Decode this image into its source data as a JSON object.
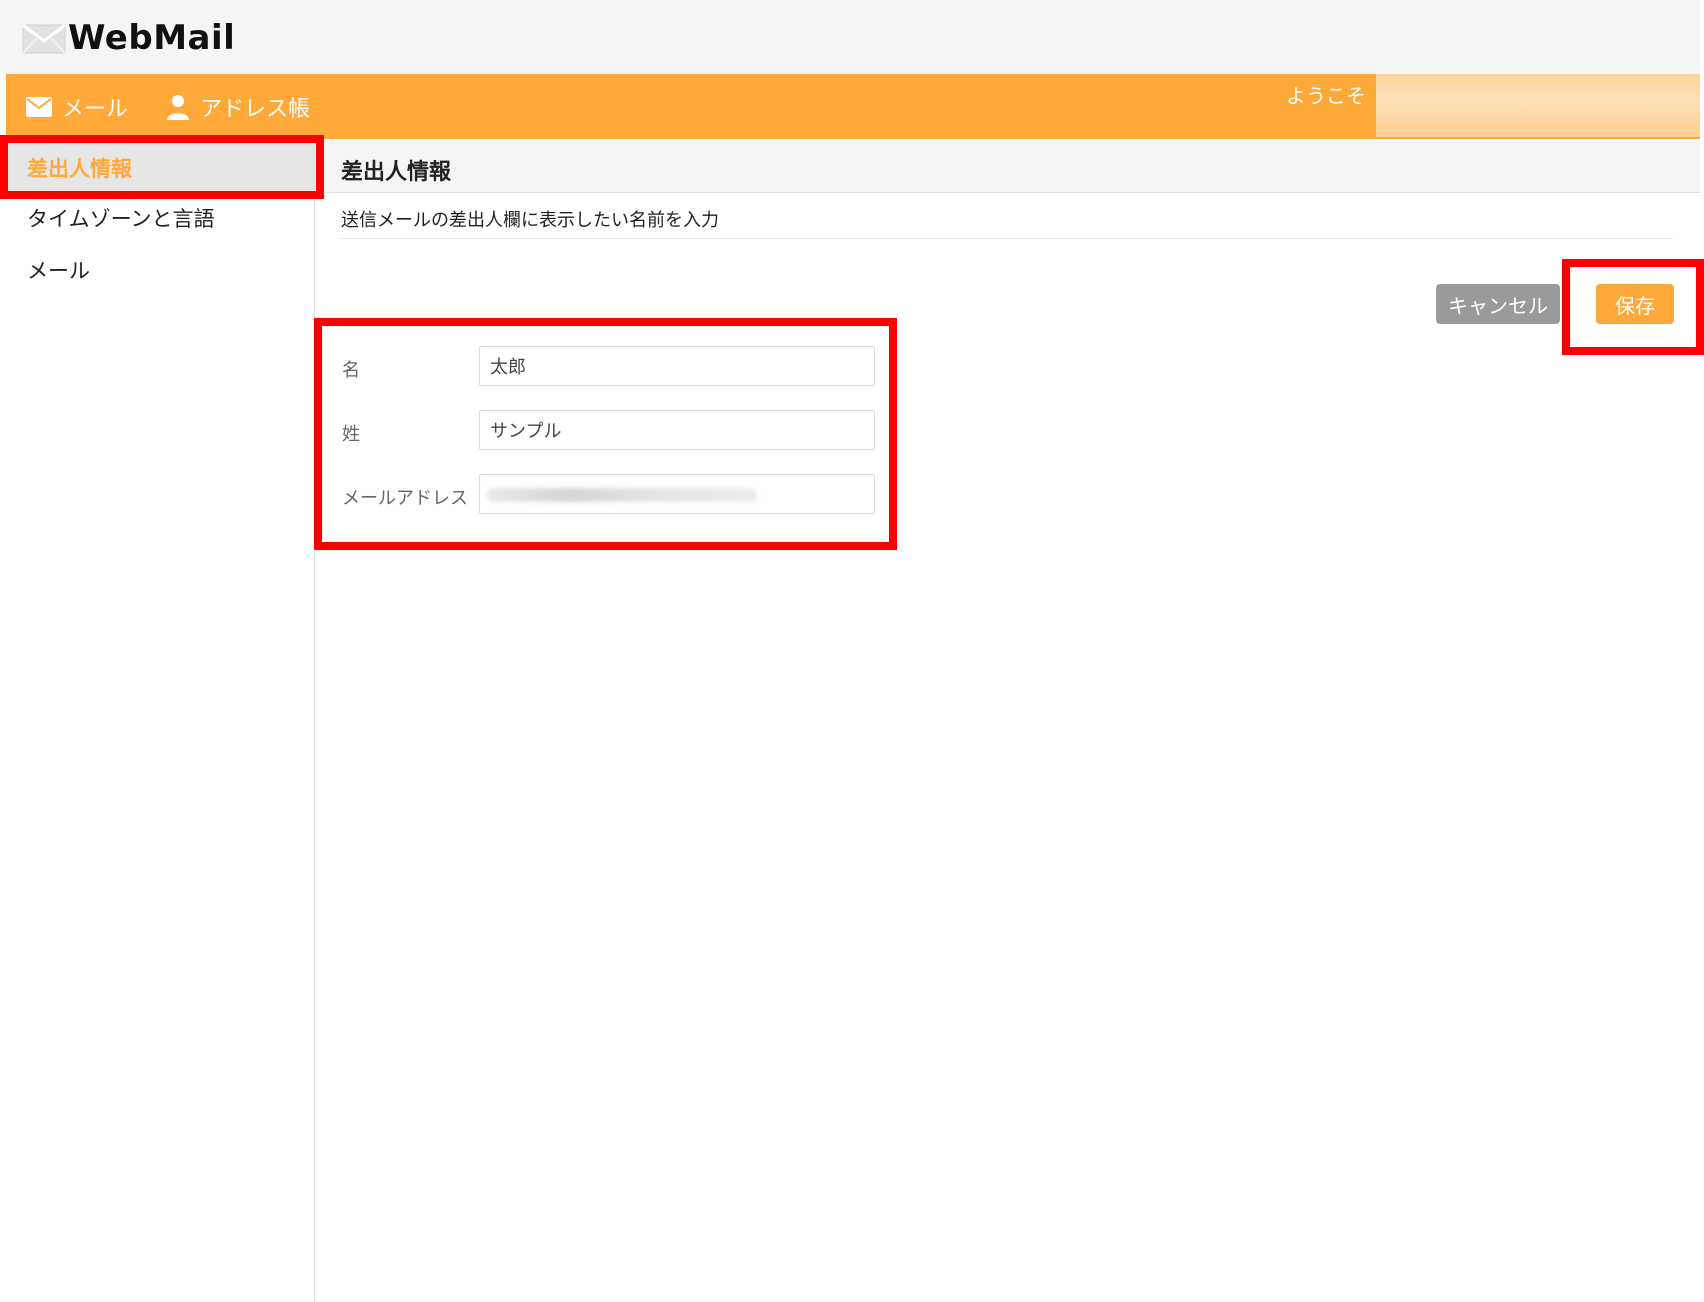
{
  "app": {
    "logo_text": "WebMail",
    "accent_color": "#ffa93a"
  },
  "nav": {
    "mail_label": "メール",
    "address_book_label": "アドレス帳",
    "welcome_label": "ようこそ"
  },
  "sidebar": {
    "items": [
      {
        "label": "差出人情報",
        "active": true
      },
      {
        "label": "タイムゾーンと言語",
        "active": false
      },
      {
        "label": "メール",
        "active": false
      }
    ]
  },
  "main": {
    "title": "差出人情報",
    "description": "送信メールの差出人欄に表示したい名前を入力",
    "cancel_label": "キャンセル",
    "save_label": "保存",
    "form": {
      "first_name_label": "名",
      "first_name_value": "太郎",
      "last_name_label": "姓",
      "last_name_value": "サンプル",
      "email_label": "メールアドレス"
    }
  },
  "colors": {
    "nav_bg": "#ffa93a",
    "cancel_bg": "#9a9a9a",
    "highlight": "#ff0000"
  }
}
